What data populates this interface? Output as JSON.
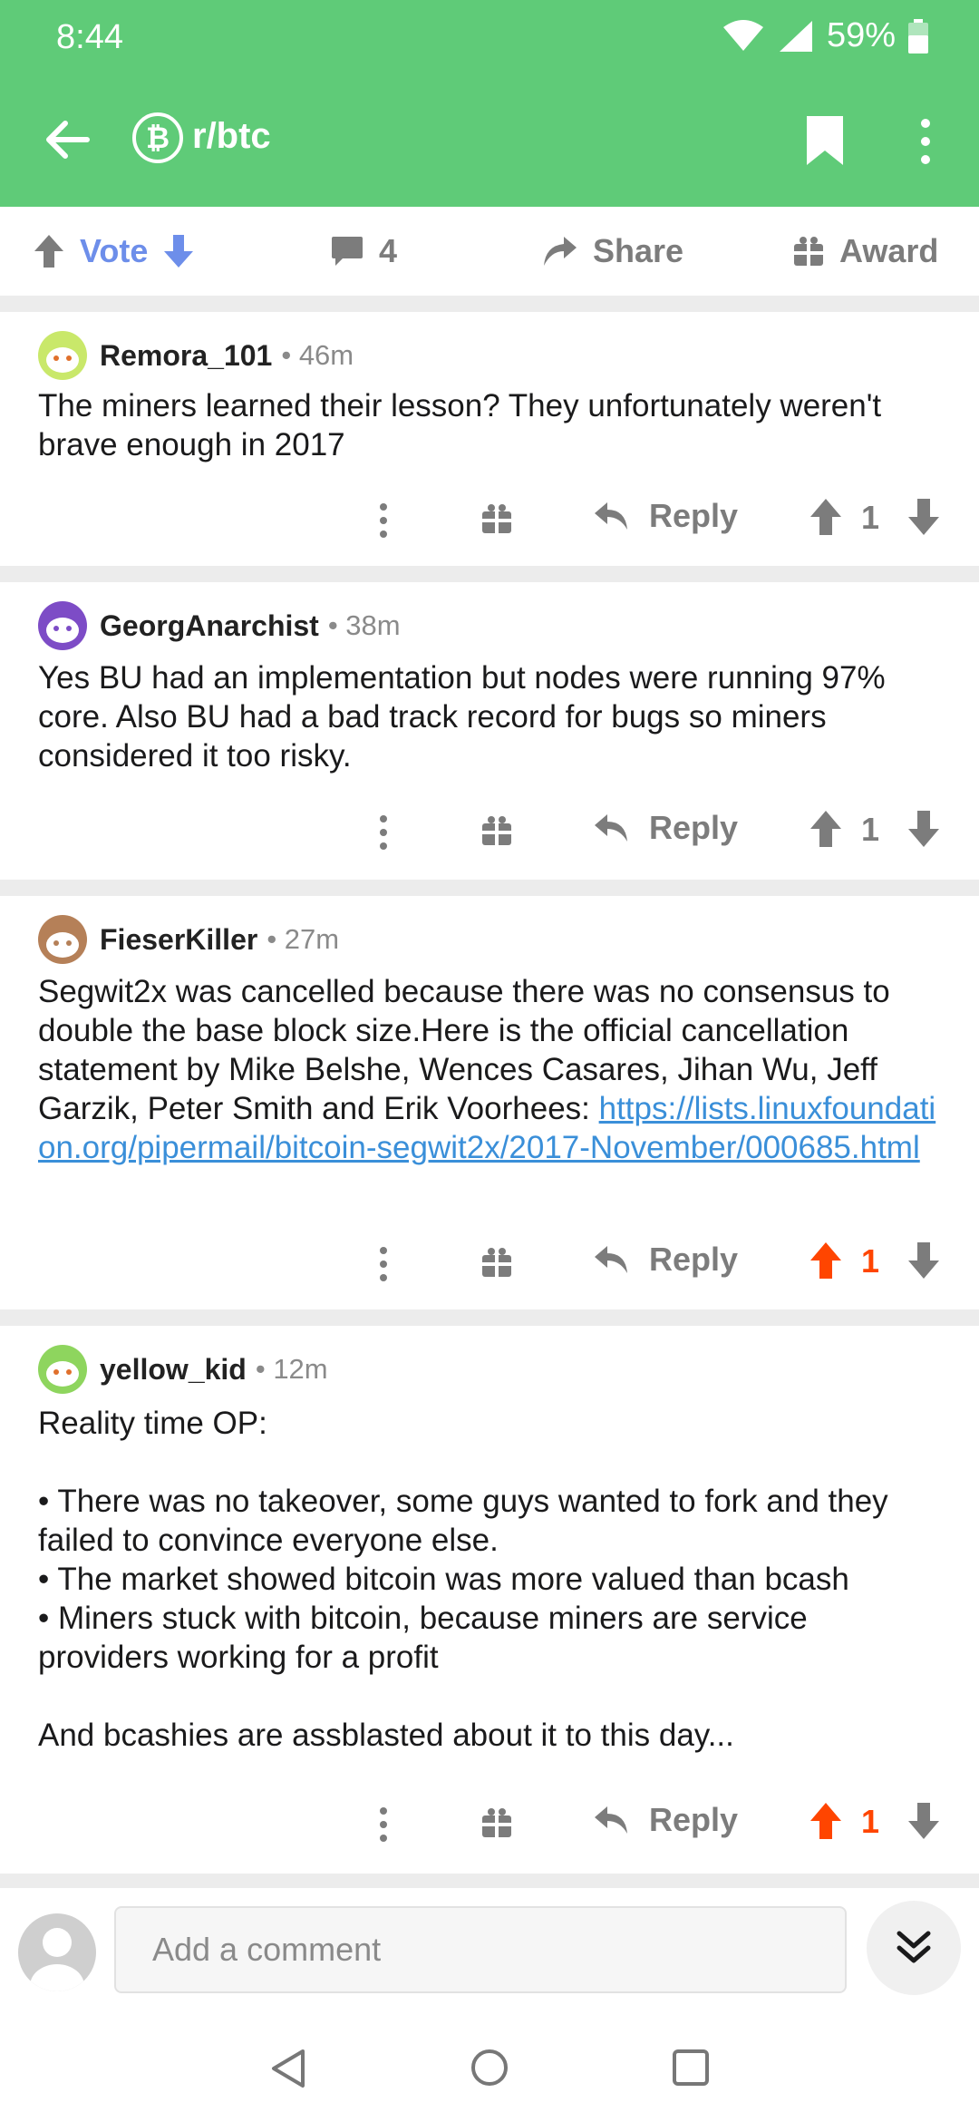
{
  "status_bar": {
    "time": "8:44",
    "battery": "59%"
  },
  "app_bar": {
    "subreddit": "r/btc",
    "subreddit_icon_glyph": "₿"
  },
  "post_actions": {
    "vote_label": "Vote",
    "comment_count": "4",
    "share_label": "Share",
    "award_label": "Award"
  },
  "colors": {
    "header_green": "#5fcb78",
    "vote_blue": "#6d8eea",
    "upvote_orange": "#ff4500",
    "link_blue": "#3a8fd9"
  },
  "comments": [
    {
      "author": "Remora_101",
      "age": "46m",
      "body": "The miners learned their lesson? They unfortunately weren't brave enough in 2017",
      "reply_label": "Reply",
      "score": "1",
      "upvoted": false
    },
    {
      "author": "GeorgAnarchist",
      "age": "38m",
      "body": "Yes BU had an implementation but nodes were running 97% core. Also BU had a bad track record for bugs so miners considered it too risky.",
      "reply_label": "Reply",
      "score": "1",
      "upvoted": false
    },
    {
      "author": "FieserKiller",
      "age": "27m",
      "body": "Segwit2x was cancelled because there was no consensus to double the base block size.Here is the official cancellation statement by Mike Belshe, Wences Casares, Jihan Wu, Jeff Garzik, Peter Smith and Erik Voorhees: ",
      "link": "https://lists.linuxfoundation.org/pipermail/bitcoin-segwit2x/2017-November/000685.html",
      "reply_label": "Reply",
      "score": "1",
      "upvoted": true
    },
    {
      "author": "yellow_kid",
      "age": "12m",
      "body": "Reality time OP:\n\n• There was no takeover, some guys wanted to fork and they failed to convince everyone else.\n• The market showed bitcoin was more valued than bcash\n• Miners stuck with bitcoin, because miners are service providers working for a profit\n\nAnd bcashies are assblasted about it to this day...",
      "reply_label": "Reply",
      "score": "1",
      "upvoted": true
    }
  ],
  "composer": {
    "placeholder": "Add a comment"
  }
}
